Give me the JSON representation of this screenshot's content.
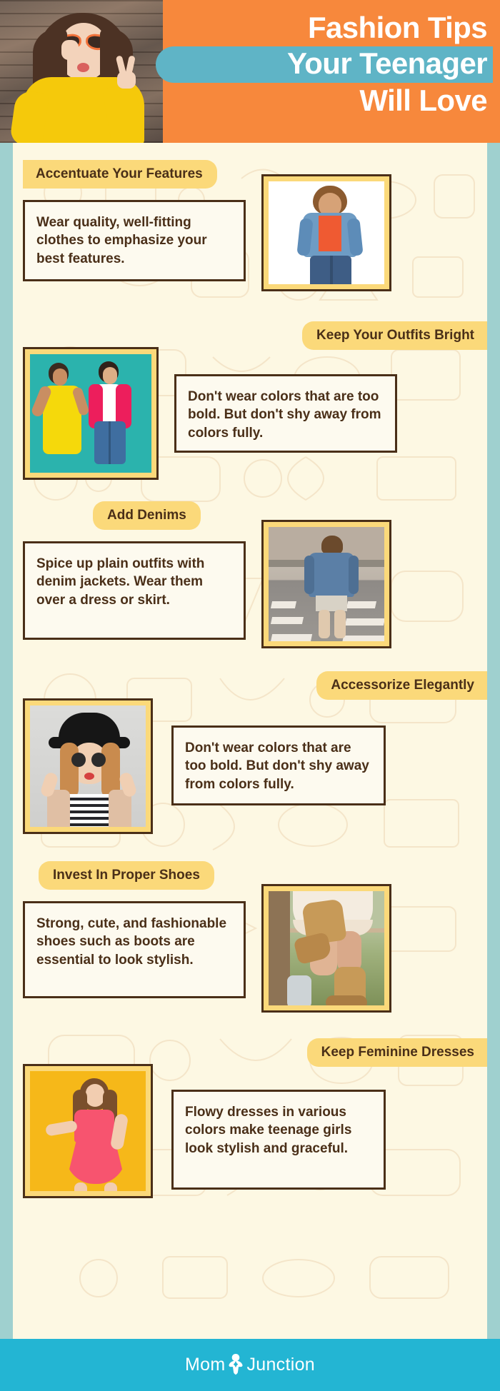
{
  "header": {
    "title_line1": "Fashion Tips",
    "title_line2": "Your Teenager",
    "title_line3": "Will Love",
    "photo_alt": "teen-girl-heart-sunglasses-yellow-sweater",
    "bg_color": "#f7883c",
    "highlight_color": "#5fb4c6",
    "title_color": "#ffffff"
  },
  "theme": {
    "paper_color": "#fdf8e3",
    "pill_color": "#fbd97a",
    "border_color": "#4a2f18",
    "side_band_color": "#9fd0cf",
    "text_color": "#4a2f18"
  },
  "sections": [
    {
      "id": "accentuate-your-features",
      "heading": "Accentuate Your Features",
      "body": "Wear quality, well-fitting clothes to emphasize your best features.",
      "heading_side": "left",
      "image_side": "right",
      "image_alt": "woman-in-denim-jacket-orange-top-white-background"
    },
    {
      "id": "keep-your-outfits-bright",
      "heading": "Keep Your Outfits Bright",
      "body": "Don't wear colors that are too bold. But don't shy away from colors fully.",
      "heading_side": "right",
      "image_side": "left",
      "image_alt": "two-women-yellow-dress-pink-blazer-teal-background"
    },
    {
      "id": "add-denims",
      "heading": "Add Denims",
      "body": "Spice up plain outfits with denim jackets. Wear them over a dress or skirt.",
      "heading_side": "left",
      "image_side": "right",
      "image_alt": "girl-in-denim-jacket-crossing-street-crosswalk"
    },
    {
      "id": "accessorize-elegantly",
      "heading": "Accessorize Elegantly",
      "body": "Don't wear colors that are too bold. But don't shy away from colors fully.",
      "heading_side": "right",
      "image_side": "left",
      "image_alt": "woman-with-black-hat-round-sunglasses-striped-top"
    },
    {
      "id": "invest-in-proper-shoes",
      "heading": "Invest In Proper Shoes",
      "body": "Strong, cute, and fashionable shoes such as boots are essential to look stylish.",
      "heading_side": "left",
      "image_side": "right",
      "image_alt": "legs-in-brown-cowboy-boots-lace-skirt-outdoors"
    },
    {
      "id": "keep-feminine-dresses",
      "heading": "Keep Feminine Dresses",
      "body": "Flowy dresses in various colors make teenage girls look stylish and graceful.",
      "heading_side": "right",
      "image_side": "left",
      "image_alt": "woman-in-pink-dress-on-yellow-background"
    }
  ],
  "footer": {
    "brand_part1": "Mom",
    "brand_part2": "Junction",
    "bg_color": "#23b5d3",
    "text_color": "#ffffff",
    "logo_icon": "mother-and-baby-icon"
  }
}
